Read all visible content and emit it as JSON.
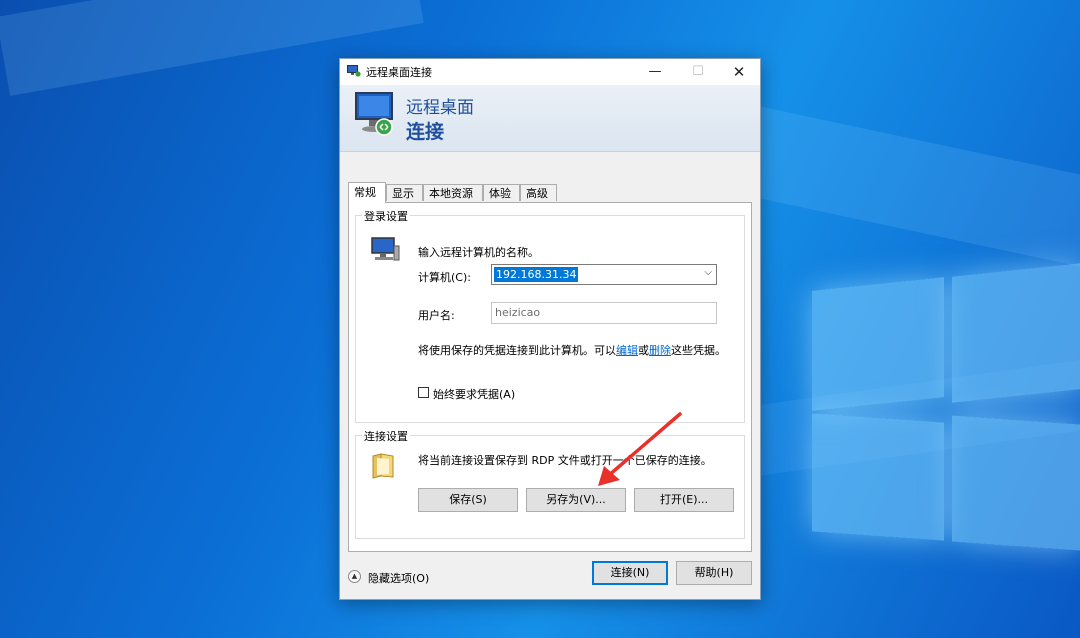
{
  "window": {
    "title": "远程桌面连接",
    "minimize_icon": "minimize-icon",
    "maximize_icon": "maximize-icon",
    "close_icon": "close-icon"
  },
  "banner": {
    "line1": "远程桌面",
    "line2": "连接"
  },
  "tabs": [
    {
      "label": "常规",
      "active": true
    },
    {
      "label": "显示",
      "active": false
    },
    {
      "label": "本地资源",
      "active": false
    },
    {
      "label": "体验",
      "active": false
    },
    {
      "label": "高级",
      "active": false
    }
  ],
  "login": {
    "group_title": "登录设置",
    "prompt": "输入远程计算机的名称。",
    "computer_label": "计算机(C):",
    "computer_value": "192.168.31.34",
    "username_label": "用户名:",
    "username_value": "heizicao",
    "cred_text_before": "将使用保存的凭据连接到此计算机。可以",
    "cred_link_edit": "编辑",
    "cred_text_mid": "或",
    "cred_link_delete": "删除",
    "cred_text_after": "这些凭据。",
    "always_ask_label": "始终要求凭据(A)",
    "always_ask_checked": false
  },
  "connection": {
    "group_title": "连接设置",
    "description": "将当前连接设置保存到 RDP 文件或打开一个已保存的连接。",
    "save_label": "保存(S)",
    "save_as_label": "另存为(V)...",
    "open_label": "打开(E)..."
  },
  "footer": {
    "hide_options_label": "隐藏选项(O)",
    "connect_label": "连接(N)",
    "help_label": "帮助(H)"
  },
  "colors": {
    "accent": "#0078d7",
    "banner_text": "#1f4f9e",
    "annotation_arrow": "#e8312a"
  }
}
